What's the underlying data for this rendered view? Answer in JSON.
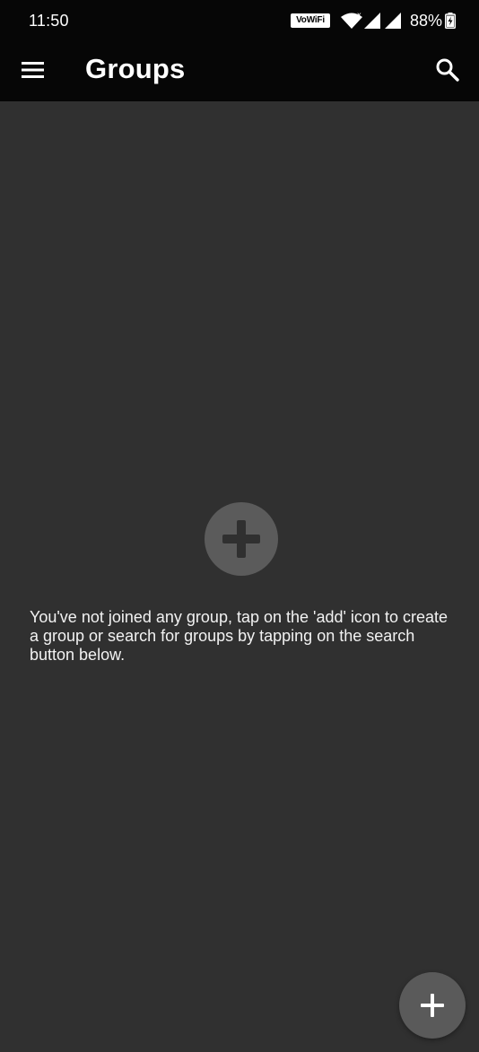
{
  "status_bar": {
    "time": "11:50",
    "vowifi_label": "VoWiFi",
    "battery_percent": "88%",
    "icons": [
      "vowifi-icon",
      "wifi-icon",
      "signal-icon",
      "signal-icon",
      "battery-charging-icon"
    ]
  },
  "app_bar": {
    "title": "Groups",
    "menu_icon": "menu-icon",
    "search_icon": "search-icon"
  },
  "empty_state": {
    "icon": "add-circle-icon",
    "message": "You've not joined any group, tap on the 'add' icon to create a group or search for groups by tapping on the search button below."
  },
  "fab": {
    "icon": "plus-icon"
  },
  "colors": {
    "background": "#303030",
    "app_bar": "#060606",
    "icon_circle": "#5b5b5b",
    "fab": "#5a5a5a",
    "text": "#ffffff"
  }
}
